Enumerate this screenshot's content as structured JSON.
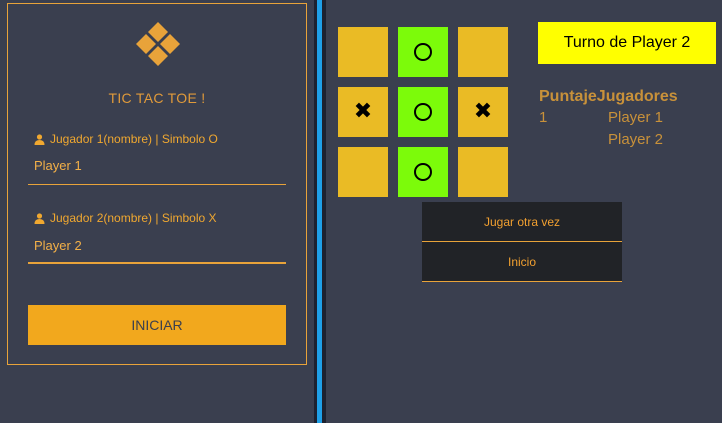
{
  "form": {
    "title": "TIC TAC TOE !",
    "player1_label": "Jugador 1(nombre) | Simbolo O",
    "player1_value": "Player 1",
    "player2_label": "Jugador 2(nombre) | Simbolo X",
    "player2_value": "Player 2",
    "start_label": "INICIAR"
  },
  "board": {
    "cells": [
      {
        "mark": "",
        "highlight": false
      },
      {
        "mark": "O",
        "highlight": true
      },
      {
        "mark": "",
        "highlight": false
      },
      {
        "mark": "X",
        "highlight": false
      },
      {
        "mark": "O",
        "highlight": true
      },
      {
        "mark": "X",
        "highlight": false
      },
      {
        "mark": "",
        "highlight": false
      },
      {
        "mark": "O",
        "highlight": true
      },
      {
        "mark": "",
        "highlight": false
      }
    ]
  },
  "turn": {
    "text": "Turno de Player 2"
  },
  "score": {
    "header": "PuntajeJugadores",
    "score_value": "1",
    "players": [
      "Player 1",
      "Player 2"
    ]
  },
  "actions": {
    "play_again_label": "Jugar otra vez",
    "home_label": "Inicio"
  },
  "colors": {
    "background": "#3a3f4f",
    "accent": "#f2a81d",
    "cell": "#eabb25",
    "win_cell": "#7cfb0a",
    "turn_bg": "#ffff00",
    "divider": "#1fa0e8"
  }
}
